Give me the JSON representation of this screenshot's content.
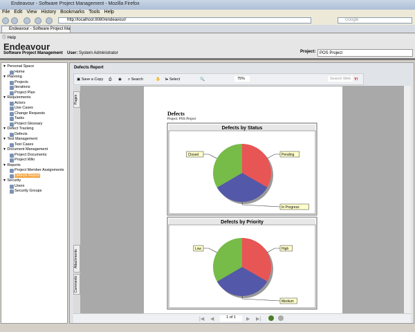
{
  "window": {
    "title": "Endeavour - Software Project Management - Mozilla Firefox"
  },
  "menu": [
    "File",
    "Edit",
    "View",
    "History",
    "Bookmarks",
    "Tools",
    "Help"
  ],
  "nav": {
    "url": "http://localhost:8080/endeavour/",
    "search_placeholder": "Google"
  },
  "tab": {
    "label": "Endeavour - Software Project Managem..."
  },
  "help": "Help",
  "header": {
    "title": "Endeavour",
    "subtitle": "Software Project Management",
    "user_label": "User:",
    "user": "System Administrator",
    "project_label": "Project:",
    "project": "POS Project"
  },
  "sidebar": [
    {
      "group": "Personal Space",
      "items": [
        "Home"
      ]
    },
    {
      "group": "Planning",
      "items": [
        "Projects",
        "Iterations",
        "Project Plan"
      ]
    },
    {
      "group": "Requirements",
      "items": [
        "Actors",
        "Use Cases",
        "Change Requests",
        "Tasks",
        "Project Glossary"
      ]
    },
    {
      "group": "Defect Tracking",
      "items": [
        "Defects"
      ]
    },
    {
      "group": "Test Management",
      "items": [
        "Test Cases"
      ]
    },
    {
      "group": "Document Management",
      "items": [
        "Project Documents",
        "Project Wiki"
      ]
    },
    {
      "group": "Reports",
      "items": [
        "Project Member Assignments",
        "Defects Report"
      ]
    },
    {
      "group": "Security",
      "items": [
        "Users",
        "Security Groups"
      ]
    }
  ],
  "selected_item": "Defects Report",
  "report": {
    "title": "Defects Report",
    "toolbar": {
      "save": "Save a Copy",
      "search": "Search",
      "select": "Select",
      "zoom": "75%",
      "search_web": "Search Web"
    },
    "side_tabs": [
      "Pages",
      "Attachments",
      "Comments"
    ],
    "page_indicator": "1 of 1",
    "doc_title": "Defects",
    "doc_project_label": "Project:",
    "doc_project": "POS Project"
  },
  "chart_data": [
    {
      "type": "pie",
      "title": "Defects by Status",
      "labels": [
        "Pending",
        "In Progress",
        "Closed"
      ],
      "values": [
        33.3,
        33.3,
        33.4
      ],
      "colors": [
        "#e85555",
        "#5358a8",
        "#77bb48"
      ]
    },
    {
      "type": "pie",
      "title": "Defects by Priority",
      "labels": [
        "High",
        "Medium",
        "Low"
      ],
      "values": [
        33.3,
        33.3,
        33.4
      ],
      "colors": [
        "#e85555",
        "#5358a8",
        "#77bb48"
      ]
    }
  ]
}
